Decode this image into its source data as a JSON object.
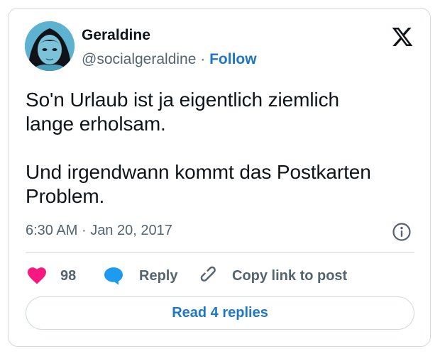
{
  "author": {
    "name": "Geraldine",
    "handle": "@socialgeraldine",
    "separator": "·",
    "follow_label": "Follow"
  },
  "tweet": {
    "text": "So'n Urlaub ist ja eigentlich ziemlich\nlange erholsam.\n\nUnd irgendwann kommt das Postkarten\nProblem."
  },
  "meta": {
    "time": "6:30 AM",
    "separator": "·",
    "date": "Jan 20, 2017"
  },
  "actions": {
    "like_count": "98",
    "reply_label": "Reply",
    "copy_label": "Copy link to post"
  },
  "read_replies_label": "Read 4 replies",
  "colors": {
    "accent": "#1d77c5",
    "like": "#f91880",
    "reply_icon": "#1d9bf0",
    "muted": "#536471",
    "border": "#cfd9de"
  },
  "icons": {
    "logo": "x-logo-icon",
    "info": "info-icon",
    "like": "heart-icon",
    "reply": "speech-bubble-icon",
    "copy": "link-icon"
  }
}
